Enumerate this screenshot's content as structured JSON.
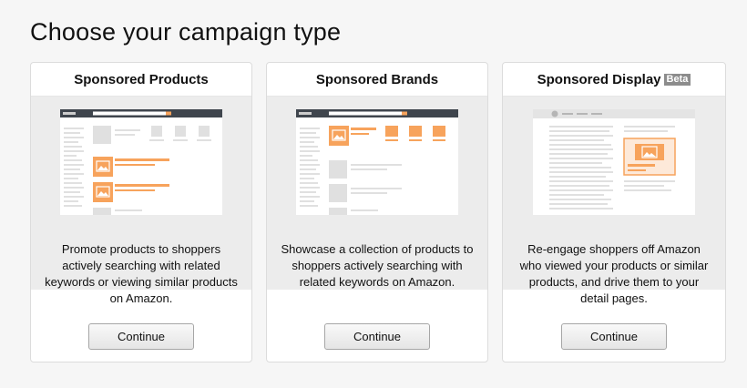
{
  "page": {
    "title": "Choose your campaign type"
  },
  "colors": {
    "accent": "#f7a35c",
    "placeholder": "#e0e0e0",
    "badge": "#8c8c8c"
  },
  "cards": [
    {
      "title": "Sponsored Products",
      "badge": "",
      "description": "Promote products to shoppers actively searching with related keywords or viewing similar products on Amazon.",
      "button": "Continue",
      "illustration": "search-results-mockup"
    },
    {
      "title": "Sponsored Brands",
      "badge": "",
      "description": "Showcase a collection of products to shoppers actively searching with related keywords on Amazon.",
      "button": "Continue",
      "illustration": "brand-banner-mockup"
    },
    {
      "title": "Sponsored Display",
      "badge": "Beta",
      "description": "Re-engage shoppers off Amazon who viewed your products or similar products, and drive them to your detail pages.",
      "button": "Continue",
      "illustration": "display-ad-mockup"
    }
  ]
}
